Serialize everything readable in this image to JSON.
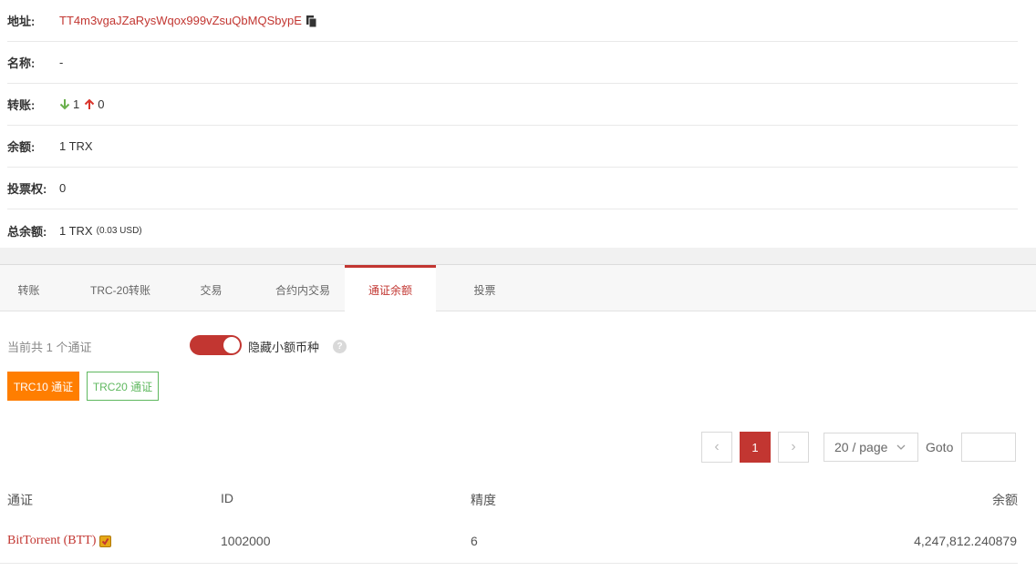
{
  "info": {
    "address_label": "地址:",
    "address_value": "TT4m3vgaJZaRysWqox999vZsuQbMQSbypE",
    "name_label": "名称:",
    "name_value": "-",
    "transfers_label": "转账:",
    "transfers_in": "1",
    "transfers_out": "0",
    "balance_label": "余额:",
    "balance_value": "1 TRX",
    "votes_label": "投票权:",
    "votes_value": "0",
    "total_label": "总余额:",
    "total_value": "1 TRX",
    "total_usd": "(0.03 USD)"
  },
  "tabs": [
    {
      "label": "转账"
    },
    {
      "label": "TRC-20转账"
    },
    {
      "label": "交易"
    },
    {
      "label": "合约内交易"
    },
    {
      "label": "通证余额"
    },
    {
      "label": "投票"
    }
  ],
  "active_tab": "通证余额",
  "filter": {
    "count_text": "当前共 1 个通证",
    "toggle_label": "隐藏小额币种",
    "toggle_on": true,
    "help_glyph": "?",
    "trc10_label": "TRC10 通证",
    "trc20_label": "TRC20 通证"
  },
  "pagination": {
    "prev": "‹",
    "current_page": "1",
    "next": "›",
    "page_size": "20 / page",
    "goto_label": "Goto",
    "goto_value": ""
  },
  "table": {
    "headers": [
      "通证",
      "ID",
      "精度",
      "余额"
    ],
    "rows": [
      {
        "token": "BitTorrent (BTT)",
        "id": "1002000",
        "precision": "6",
        "balance": "4,247,812.240879"
      }
    ]
  },
  "colors": {
    "accent": "#c23631",
    "orange": "#ff7e00",
    "green": "#5fb85f",
    "down_arrow": "#6ab04c",
    "up_arrow": "#d9342b"
  }
}
